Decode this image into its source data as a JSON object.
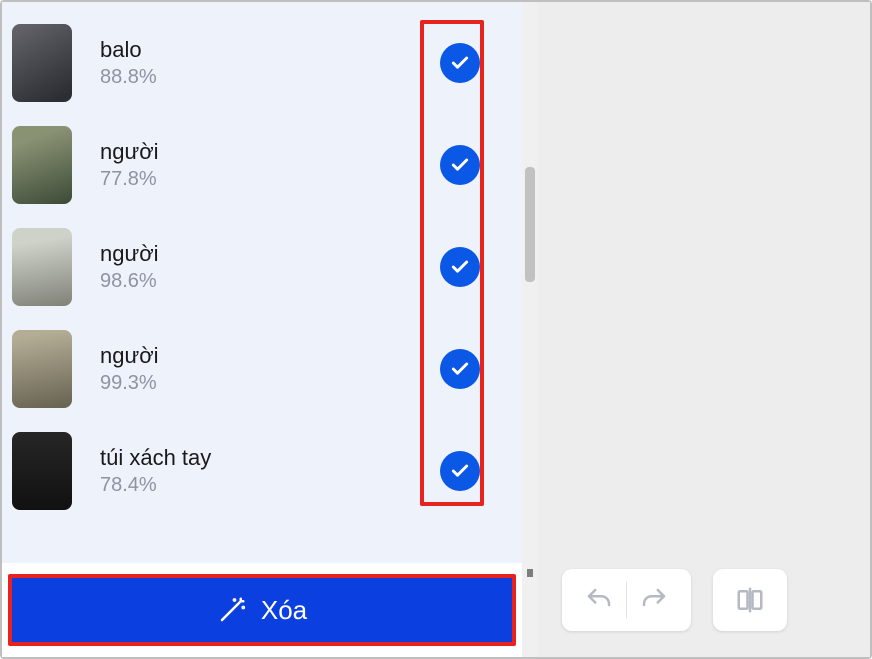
{
  "detection_list": {
    "items": [
      {
        "label": "balo",
        "confidence": "88.8%",
        "checked": true
      },
      {
        "label": "người",
        "confidence": "77.8%",
        "checked": true
      },
      {
        "label": "người",
        "confidence": "98.6%",
        "checked": true
      },
      {
        "label": "người",
        "confidence": "99.3%",
        "checked": true
      },
      {
        "label": "túi xách tay",
        "confidence": "78.4%",
        "checked": true
      }
    ]
  },
  "actions": {
    "delete_label": "Xóa"
  }
}
